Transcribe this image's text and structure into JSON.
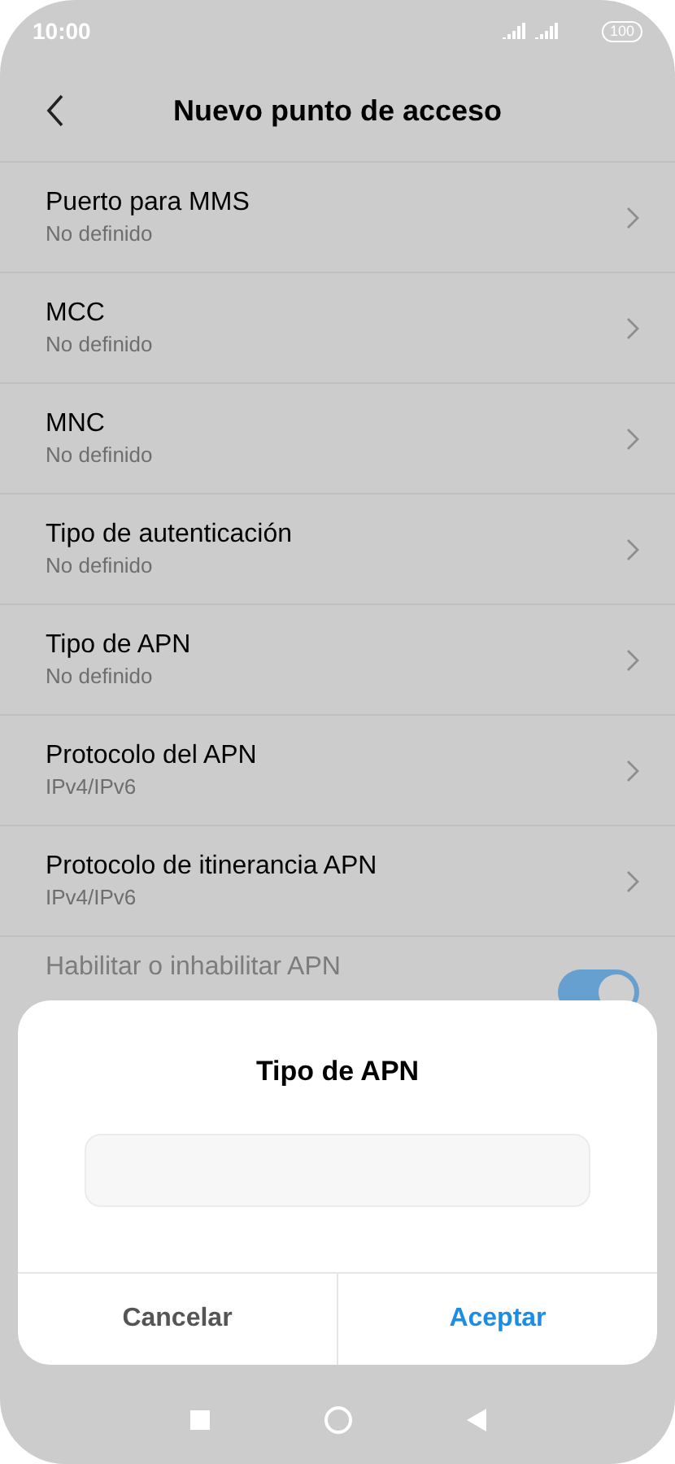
{
  "status_bar": {
    "time": "10:00",
    "battery": "100"
  },
  "header": {
    "title": "Nuevo punto de acceso"
  },
  "settings": [
    {
      "kind": "link",
      "title": "Puerto para MMS",
      "value": "No definido"
    },
    {
      "kind": "link",
      "title": "MCC",
      "value": "No definido"
    },
    {
      "kind": "link",
      "title": "MNC",
      "value": "No definido"
    },
    {
      "kind": "link",
      "title": "Tipo de autenticación",
      "value": "No definido"
    },
    {
      "kind": "link",
      "title": "Tipo de APN",
      "value": "No definido"
    },
    {
      "kind": "link",
      "title": "Protocolo del APN",
      "value": "IPv4/IPv6"
    },
    {
      "kind": "link",
      "title": "Protocolo de itinerancia APN",
      "value": "IPv4/IPv6"
    },
    {
      "kind": "toggle",
      "title": "Habilitar o inhabilitar APN",
      "on": true,
      "disabled": true
    }
  ],
  "dialog": {
    "title": "Tipo de APN",
    "buttons": [
      {
        "label": "Cancelar",
        "primary": false
      },
      {
        "label": "Aceptar",
        "primary": true
      }
    ]
  }
}
